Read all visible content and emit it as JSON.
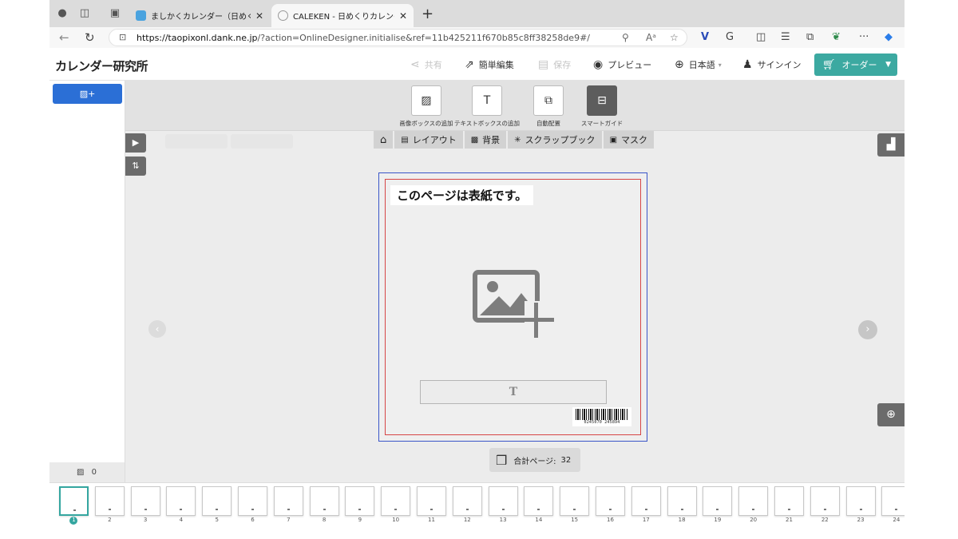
{
  "browser": {
    "tabs": [
      {
        "title": "ましかくカレンダー（日めくり）・",
        "active": false
      },
      {
        "title": "CALEKEN - 日めくりカレンダーﾃﾞ",
        "active": true
      }
    ],
    "url_host": "https://taopixonl.dank.ne.jp",
    "url_path": "/?action=OnlineDesigner.initialise&ref=11b425211f670b85c8ff38258de9#/"
  },
  "header": {
    "logo": "カレンダー研究所",
    "share": "共有",
    "simple_edit": "簡単編集",
    "save": "保存",
    "preview": "プレビュー",
    "language": "日本語",
    "signin": "サインイン",
    "order": "オーダー"
  },
  "sidebar": {
    "photo_count": "0"
  },
  "tools": [
    {
      "label": "画像ボックスの追加"
    },
    {
      "label": "テキストボックスの追加"
    },
    {
      "label": "自動配置"
    },
    {
      "label": "スマートガイド"
    }
  ],
  "tabs": [
    {
      "label": "レイアウト"
    },
    {
      "label": "背景"
    },
    {
      "label": "スクラップブック"
    },
    {
      "label": "マスク"
    }
  ],
  "canvas": {
    "cover_title": "このページは表紙です。",
    "text_placeholder": "T",
    "barcode_number": "0245070 245894"
  },
  "page_count": {
    "label": "合計ページ:",
    "value": "32"
  },
  "thumbnails": [
    "1",
    "2",
    "3",
    "4",
    "5",
    "6",
    "7",
    "8",
    "9",
    "10",
    "11",
    "12",
    "13",
    "14",
    "15",
    "16",
    "17",
    "18",
    "19",
    "20",
    "21",
    "22",
    "23",
    "24"
  ],
  "colors": {
    "accent": "#3ca9a1",
    "primary_button": "#2b6fd6",
    "bleed_line": "#3a55c8",
    "safe_line": "#d64545"
  }
}
